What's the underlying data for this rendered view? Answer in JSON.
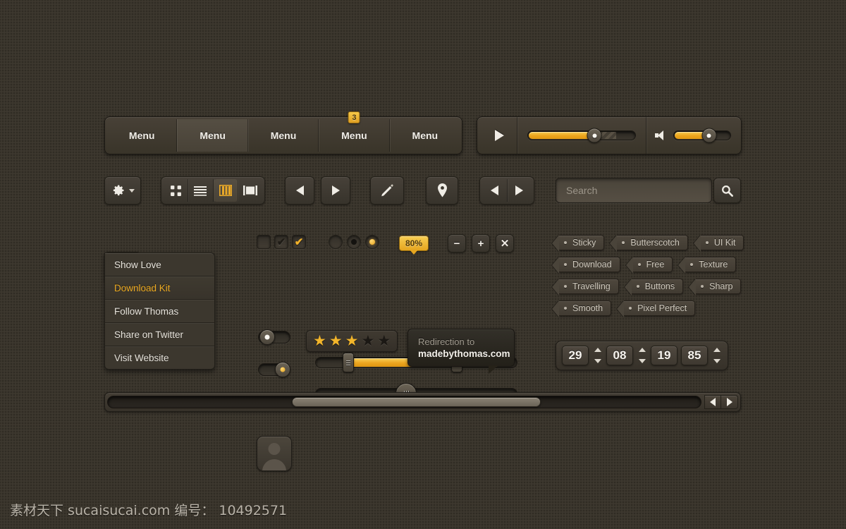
{
  "menu_bar": {
    "items": [
      {
        "label": "Menu",
        "active": false,
        "badge": null
      },
      {
        "label": "Menu",
        "active": true,
        "badge": null
      },
      {
        "label": "Menu",
        "active": false,
        "badge": null
      },
      {
        "label": "Menu",
        "active": false,
        "badge": "3"
      },
      {
        "label": "Menu",
        "active": false,
        "badge": null
      }
    ]
  },
  "player": {
    "play_icon": "play-icon",
    "progress_percent": 62,
    "buffer_percent": 82,
    "volume_icon": "speaker-icon",
    "volume_percent": 62
  },
  "toolbar": {
    "gear_icon": "gear-icon",
    "gear_caret": "chevron-down-icon",
    "view_modes": [
      {
        "name": "grid-view-icon",
        "active": false
      },
      {
        "name": "list-view-icon",
        "active": false
      },
      {
        "name": "column-view-icon",
        "active": true
      },
      {
        "name": "gallery-view-icon",
        "active": false
      }
    ],
    "prev_icon": "arrow-left-icon",
    "next_icon": "arrow-right-icon",
    "edit_icon": "pencil-icon",
    "location_icon": "map-pin-icon",
    "pager_prev_icon": "arrow-left-icon",
    "pager_next_icon": "arrow-right-icon",
    "search_placeholder": "Search",
    "search_value": "",
    "search_button_icon": "search-icon"
  },
  "dropdown": {
    "trigger_icon": "gear-icon",
    "trigger_caret": "chevron-down-icon",
    "items": [
      {
        "label": "Show Love",
        "highlighted": false
      },
      {
        "label": "Download Kit",
        "highlighted": true
      },
      {
        "label": "Follow Thomas",
        "highlighted": false
      },
      {
        "label": "Share on Twitter",
        "highlighted": false
      },
      {
        "label": "Visit Website",
        "highlighted": false
      }
    ]
  },
  "controls": {
    "checkboxes": [
      {
        "state": "unchecked",
        "mark": ""
      },
      {
        "state": "checked-dark",
        "mark": "✔"
      },
      {
        "state": "checked-gold",
        "mark": "✔"
      }
    ],
    "radios": [
      {
        "state": "empty"
      },
      {
        "state": "selected-dark"
      },
      {
        "state": "selected-gold"
      }
    ],
    "percent_badge": "80%",
    "minus_label": "−",
    "plus_label": "+",
    "close_label": "✕",
    "toggles": [
      {
        "state": "off"
      },
      {
        "state": "on"
      }
    ],
    "range_slider": {
      "start_percent": 16,
      "end_percent": 70
    },
    "single_slider": {
      "value_percent": 45
    }
  },
  "media_row": {
    "avatar_icon": "user-avatar-icon",
    "rating": {
      "filled": 3,
      "total": 5,
      "star_glyph": "★"
    },
    "tooltip": {
      "line1": "Redirection to",
      "line2": "madebythomas.com"
    }
  },
  "tags": {
    "rows": [
      [
        "Sticky",
        "Butterscotch",
        "UI Kit"
      ],
      [
        "Download",
        "Free",
        "Texture"
      ],
      [
        "Travelling",
        "Buttons",
        "Sharp"
      ],
      [
        "Smooth",
        "Pixel Perfect"
      ]
    ]
  },
  "date_stepper": {
    "fields": [
      {
        "value": "29",
        "has_spinner": true
      },
      {
        "value": "08",
        "has_spinner": true
      },
      {
        "value": "19",
        "has_spinner": false
      },
      {
        "value": "85",
        "has_spinner": true
      }
    ]
  },
  "scrollbar": {
    "thumb_left_percent": 31,
    "thumb_width_percent": 42,
    "left_arrow_icon": "arrow-left-icon",
    "right_arrow_icon": "arrow-right-icon"
  },
  "watermark": {
    "text": "素材天下 sucaisucai.com  编号： 10492571"
  },
  "colors": {
    "background": "#3a352c",
    "accent": "#eba41c",
    "panel": "#3e3930",
    "text": "#efece6"
  }
}
